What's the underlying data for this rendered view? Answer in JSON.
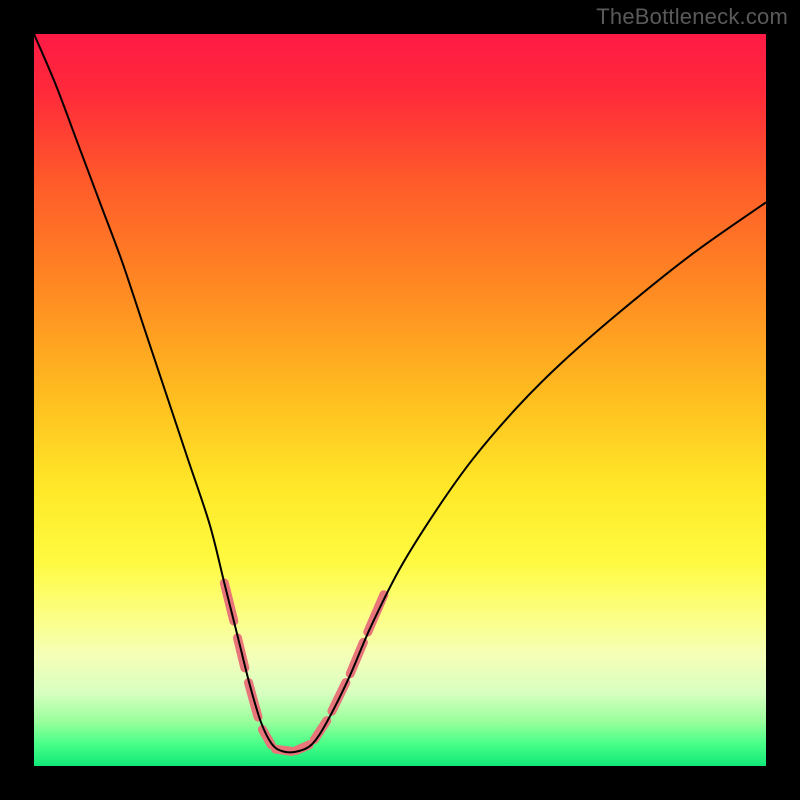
{
  "watermark": "TheBottleneck.com",
  "chart_data": {
    "type": "line",
    "title": "",
    "xlabel": "",
    "ylabel": "",
    "xlim": [
      0,
      100
    ],
    "ylim": [
      0,
      100
    ],
    "gradient_stops": [
      {
        "offset": 0.0,
        "color": "#ff1a45"
      },
      {
        "offset": 0.08,
        "color": "#ff2a3a"
      },
      {
        "offset": 0.2,
        "color": "#ff5a2a"
      },
      {
        "offset": 0.35,
        "color": "#ff8a22"
      },
      {
        "offset": 0.5,
        "color": "#ffbf20"
      },
      {
        "offset": 0.62,
        "color": "#ffe828"
      },
      {
        "offset": 0.72,
        "color": "#fffa40"
      },
      {
        "offset": 0.8,
        "color": "#fbff88"
      },
      {
        "offset": 0.85,
        "color": "#f4ffb8"
      },
      {
        "offset": 0.9,
        "color": "#d8ffc0"
      },
      {
        "offset": 0.94,
        "color": "#98ff9c"
      },
      {
        "offset": 0.97,
        "color": "#48ff88"
      },
      {
        "offset": 1.0,
        "color": "#10e878"
      }
    ],
    "series": [
      {
        "name": "bottleneck-curve",
        "stroke": "#000000",
        "stroke_width": 2,
        "x": [
          0,
          3,
          6,
          9,
          12,
          15,
          18,
          21,
          24,
          26,
          28,
          29.5,
          31,
          32.5,
          34,
          36,
          38,
          40,
          43,
          46,
          50,
          55,
          60,
          66,
          72,
          80,
          90,
          100
        ],
        "y": [
          100,
          93,
          85,
          77,
          69,
          60,
          51,
          42,
          33,
          25,
          17,
          11,
          6,
          3,
          2,
          2,
          3,
          6,
          12,
          19,
          27,
          35,
          42,
          49,
          55,
          62,
          70,
          77
        ]
      }
    ],
    "highlight_segments": {
      "stroke": "#e8757a",
      "stroke_width": 9,
      "linecap": "round",
      "segments": [
        {
          "x1": 26.0,
          "y1": 25.0,
          "x2": 27.3,
          "y2": 19.8
        },
        {
          "x1": 27.8,
          "y1": 17.5,
          "x2": 28.8,
          "y2": 13.4
        },
        {
          "x1": 29.3,
          "y1": 11.4,
          "x2": 30.6,
          "y2": 6.7
        },
        {
          "x1": 31.2,
          "y1": 5.0,
          "x2": 32.4,
          "y2": 2.9
        },
        {
          "x1": 33.0,
          "y1": 2.3,
          "x2": 35.2,
          "y2": 2.0
        },
        {
          "x1": 35.8,
          "y1": 2.1,
          "x2": 37.6,
          "y2": 2.9
        },
        {
          "x1": 38.3,
          "y1": 3.6,
          "x2": 40.0,
          "y2": 6.2
        },
        {
          "x1": 40.7,
          "y1": 7.5,
          "x2": 42.6,
          "y2": 11.4
        },
        {
          "x1": 43.2,
          "y1": 12.6,
          "x2": 45.0,
          "y2": 16.9
        },
        {
          "x1": 45.6,
          "y1": 18.3,
          "x2": 47.8,
          "y2": 23.4
        }
      ]
    }
  }
}
